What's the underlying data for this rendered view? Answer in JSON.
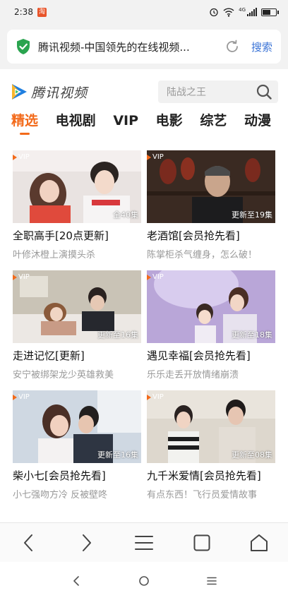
{
  "status_bar": {
    "time": "2:38",
    "battery_level": 0.6,
    "network": "4G"
  },
  "browser": {
    "page_title": "腾讯视频-中国领先的在线视频...",
    "search_label": "搜索",
    "shield_color": "#2aa44f",
    "link_color": "#3a73d6"
  },
  "site": {
    "logo_text": "腾讯视频",
    "search_placeholder": "陆战之王",
    "accent_color": "#f36a1a"
  },
  "tabs": [
    {
      "label": "精选",
      "active": true
    },
    {
      "label": "电视剧",
      "active": false
    },
    {
      "label": "VIP",
      "active": false
    },
    {
      "label": "电影",
      "active": false
    },
    {
      "label": "综艺",
      "active": false
    },
    {
      "label": "动漫",
      "active": false
    }
  ],
  "cards": [
    {
      "title": "全职高手[20点更新]",
      "subtitle": "叶修沐橙上演摸头杀",
      "badge": "VIP",
      "episode": "全40集"
    },
    {
      "title": "老酒馆[会员抢先看]",
      "subtitle": "陈掌柜杀气缠身，怎么破！",
      "badge": "VIP",
      "episode": "更新至19集"
    },
    {
      "title": "走进记忆[更新]",
      "subtitle": "安宁被绑架龙少英雄救美",
      "badge": "VIP",
      "episode": "更新至16集"
    },
    {
      "title": "遇见幸福[会员抢先看]",
      "subtitle": "乐乐走丢开放情绪崩溃",
      "badge": "VIP",
      "episode": "更新至18集"
    },
    {
      "title": "柴小七[会员抢先看]",
      "subtitle": "小七强吻方冷 反被壁咚",
      "badge": "VIP",
      "episode": "更新至16集"
    },
    {
      "title": "九千米爱情[会员抢先看]",
      "subtitle": "有点东西！飞行员爱情故事",
      "badge": "VIP",
      "episode": "更新至08集"
    }
  ],
  "browser_nav": [
    "back-icon",
    "forward-icon",
    "menu-icon",
    "tabs-icon",
    "home-icon"
  ],
  "system_nav": [
    "back-icon",
    "home-icon",
    "recents-icon"
  ]
}
